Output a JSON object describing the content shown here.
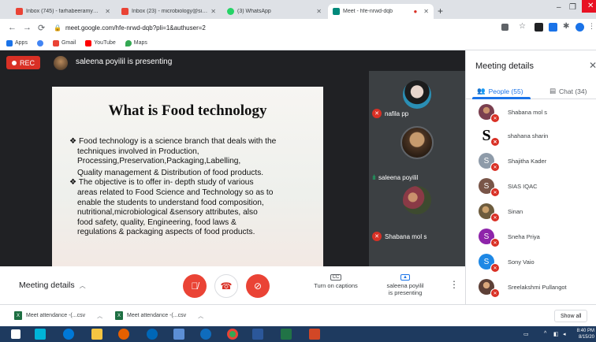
{
  "browser": {
    "tabs": [
      {
        "label": "Inbox (745) - farhabeeramy@gm...",
        "color": "#ea4335",
        "active": false
      },
      {
        "label": "Inbox (23) - microbiology@siasi...",
        "color": "#ea4335",
        "active": false
      },
      {
        "label": "(3) WhatsApp",
        "color": "#25d366",
        "active": false
      },
      {
        "label": "Meet - hfe-nrwd-dqb",
        "color": "#00897b",
        "active": true
      }
    ],
    "url": "meet.google.com/hfe-nrwd-dqb?pli=1&authuser=2",
    "bookmarks": [
      "Apps",
      "Gmail",
      "YouTube",
      "Maps"
    ]
  },
  "stage": {
    "rec_label": "REC",
    "presenting_text": "saleena poyilil is presenting"
  },
  "slide": {
    "title": "What is Food technology",
    "para1_l1": "❖ Food technology is a science branch that deals with the",
    "para1_l2": "techniques involved in Production,",
    "para1_l3": "Processing,Preservation,Packaging,Labelling,",
    "para1_l4": "Quality management & Distribution of food products.",
    "para2_l1": "❖ The objective is  to offer in- depth study of various",
    "para2_l2": "areas related to Food Science and Technology so as to",
    "para2_l3": "enable the students to understand food composition,",
    "para2_l4": "nutritional,microbiological &sensory attributes, also",
    "para2_l5": "food safety, quality, Engineering, food laws &",
    "para2_l6": "regulations & packaging aspects of food products."
  },
  "tiles": [
    {
      "name": "nafila pp",
      "muted": true,
      "color": "#2a8fb5"
    },
    {
      "name": "saleena poyilil",
      "muted": false,
      "color": "#6b4a2e"
    },
    {
      "name": "Shabana mol s",
      "muted": true,
      "color": "#8a3a46"
    }
  ],
  "panel": {
    "title": "Meeting details",
    "people_tab": "People (55)",
    "chat_tab": "Chat (34)",
    "people": [
      {
        "name": "Shabana mol s",
        "initial": "",
        "color": "#7a3f4f"
      },
      {
        "name": "shahana sharin",
        "initial": "S",
        "color": "big"
      },
      {
        "name": "Shajitha Kader",
        "initial": "S",
        "color": "#8e9ba9"
      },
      {
        "name": "SIAS IQAC",
        "initial": "S",
        "color": "#795548"
      },
      {
        "name": "Sinan",
        "initial": "",
        "color": "#6d5c3e"
      },
      {
        "name": "Sneha Priya",
        "initial": "S",
        "color": "#8e24aa"
      },
      {
        "name": "Sony Vaio",
        "initial": "S",
        "color": "#1e88e5"
      },
      {
        "name": "Sreelakshmi Pullangot",
        "initial": "",
        "color": "#5d4037"
      }
    ]
  },
  "controls": {
    "meeting_details": "Meeting details",
    "captions_label": "Turn on captions",
    "presenting_l1": "saleena poyilil",
    "presenting_l2": "is presenting"
  },
  "downloads": {
    "item1": "Meet attendance -(...csv",
    "item2": "Meet attendance -(...csv",
    "show_all": "Show all"
  },
  "taskbar": {
    "time": "8:40 PM",
    "date": "8/15/20"
  }
}
